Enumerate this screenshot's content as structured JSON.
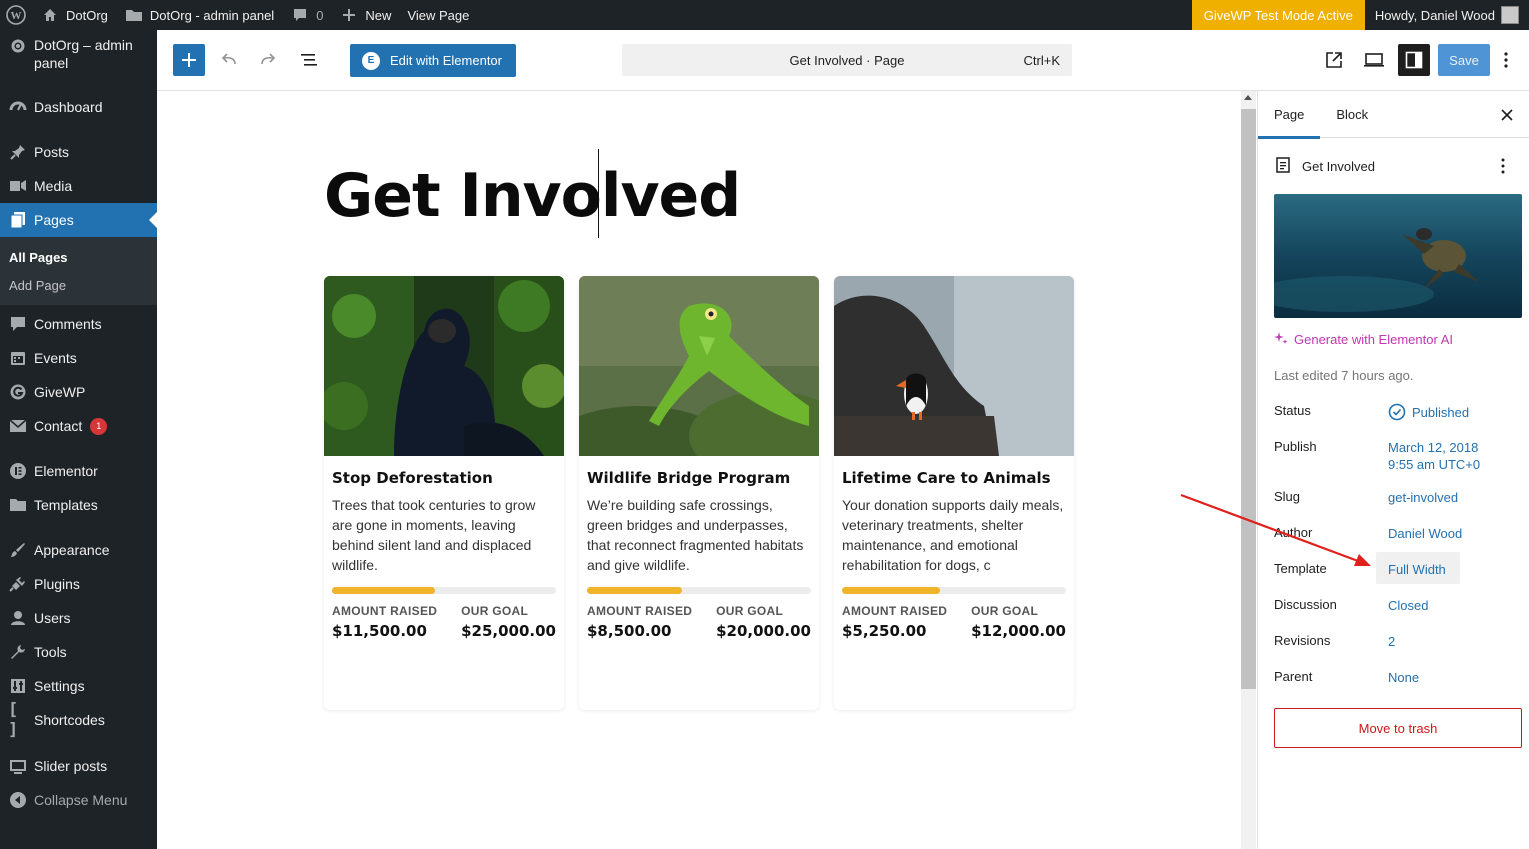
{
  "adminbar": {
    "site_name": "DotOrg",
    "panel_name": "DotOrg - admin panel",
    "comments_count": "0",
    "new_label": "New",
    "view_page_label": "View Page",
    "givewp_badge": "GiveWP Test Mode Active",
    "howdy": "Howdy, Daniel Wood"
  },
  "sidebar": {
    "site_label": "DotOrg – admin panel",
    "items": [
      {
        "label": "Dashboard",
        "icon": "dashboard-icon"
      },
      {
        "label": "Posts",
        "icon": "pin-icon"
      },
      {
        "label": "Media",
        "icon": "media-icon"
      },
      {
        "label": "Pages",
        "icon": "pages-icon"
      },
      {
        "label": "Comments",
        "icon": "comment-icon"
      },
      {
        "label": "Events",
        "icon": "calendar-icon"
      },
      {
        "label": "GiveWP",
        "icon": "givewp-icon"
      },
      {
        "label": "Contact",
        "icon": "mail-icon",
        "badge": "1"
      },
      {
        "label": "Elementor",
        "icon": "elementor-icon"
      },
      {
        "label": "Templates",
        "icon": "folder-icon"
      },
      {
        "label": "Appearance",
        "icon": "brush-icon"
      },
      {
        "label": "Plugins",
        "icon": "plug-icon"
      },
      {
        "label": "Users",
        "icon": "user-icon"
      },
      {
        "label": "Tools",
        "icon": "wrench-icon"
      },
      {
        "label": "Settings",
        "icon": "settings-icon"
      },
      {
        "label": "Shortcodes",
        "icon": "brackets-icon"
      },
      {
        "label": "Slider posts",
        "icon": "slider-icon"
      },
      {
        "label": "Collapse Menu",
        "icon": "collapse-icon"
      }
    ],
    "submenu": {
      "all_pages": "All Pages",
      "add_page": "Add Page"
    }
  },
  "header": {
    "edit_elementor": "Edit with Elementor",
    "command_title": "Get Involved · Page",
    "command_shortcut": "Ctrl+K",
    "save": "Save"
  },
  "canvas": {
    "title": "Get Involved",
    "cards": [
      {
        "title": "Stop Deforestation",
        "text": "Trees that took centuries to grow are gone in moments, leaving behind silent land and displaced wildlife.",
        "progress": 0.46,
        "raised_label": "AMOUNT RAISED",
        "raised": "$11,500.00",
        "goal_label": "OUR GOAL",
        "goal": "$25,000.00"
      },
      {
        "title": "Wildlife Bridge Program",
        "text": "We’re building safe crossings, green bridges and underpasses, that reconnect fragmented habitats and give wildlife.",
        "progress": 0.425,
        "raised_label": "AMOUNT RAISED",
        "raised": "$8,500.00",
        "goal_label": "OUR GOAL",
        "goal": "$20,000.00"
      },
      {
        "title": "Lifetime Care to Animals",
        "text": "Your donation supports daily meals, veterinary treatments, shelter maintenance, and emotional rehabilitation for dogs, c",
        "progress": 0.4375,
        "raised_label": "AMOUNT RAISED",
        "raised": "$5,250.00",
        "goal_label": "OUR GOAL",
        "goal": "$12,000.00"
      }
    ]
  },
  "settings": {
    "tab_page": "Page",
    "tab_block": "Block",
    "doc_title": "Get Involved",
    "ai_link": "Generate with Elementor AI",
    "last_edited": "Last edited 7 hours ago.",
    "status_label": "Status",
    "status_value": "Published",
    "publish_label": "Publish",
    "publish_date": "March 12, 2018",
    "publish_time": "9:55 am UTC+0",
    "slug_label": "Slug",
    "slug_value": "get-involved",
    "author_label": "Author",
    "author_value": "Daniel Wood",
    "template_label": "Template",
    "template_value": "Full Width",
    "discussion_label": "Discussion",
    "discussion_value": "Closed",
    "revisions_label": "Revisions",
    "revisions_value": "2",
    "parent_label": "Parent",
    "parent_value": "None",
    "trash": "Move to trash"
  },
  "colors": {
    "admin_bg": "#1d2327",
    "accent": "#2271b1",
    "givewp": "#f0b000",
    "progress": "#f0b429",
    "danger": "#cc1818",
    "ai": "#c036b3",
    "arrow": "#e0201b"
  }
}
